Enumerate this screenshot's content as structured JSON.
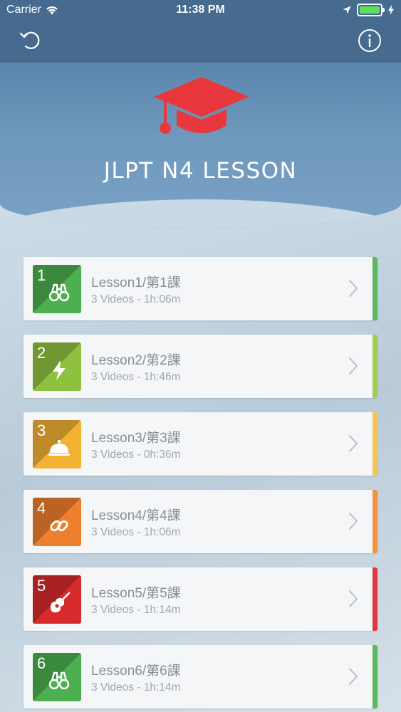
{
  "status_bar": {
    "carrier": "Carrier",
    "time": "11:38 PM"
  },
  "nav": {
    "reload_icon": "reload-icon",
    "info_icon": "info-icon"
  },
  "header": {
    "title": "JLPT N4 LESSON",
    "icon": "graduation-cap-icon",
    "icon_color": "#e8383e"
  },
  "lessons": [
    {
      "number": "1",
      "title": "Lesson1/第1課",
      "subtitle": "3 Videos - 1h:06m",
      "color": "#4caf50",
      "stripe": "#5cb85c",
      "icon": "binoculars-icon"
    },
    {
      "number": "2",
      "title": "Lesson2/第2課",
      "subtitle": "3 Videos - 1h:46m",
      "color": "#8fc140",
      "stripe": "#a3cc52",
      "icon": "lightning-icon"
    },
    {
      "number": "3",
      "title": "Lesson3/第3課",
      "subtitle": "3 Videos - 0h:36m",
      "color": "#f4b233",
      "stripe": "#f6c35a",
      "icon": "service-bell-icon"
    },
    {
      "number": "4",
      "title": "Lesson4/第4課",
      "subtitle": "3 Videos - 1h:06m",
      "color": "#ee7f2c",
      "stripe": "#f09443",
      "icon": "link-icon"
    },
    {
      "number": "5",
      "title": "Lesson5/第5課",
      "subtitle": "3 Videos - 1h:14m",
      "color": "#d62a2d",
      "stripe": "#dc3a3f",
      "icon": "guitar-icon"
    },
    {
      "number": "6",
      "title": "Lesson6/第6課",
      "subtitle": "3 Videos - 1h:14m",
      "color": "#4caf50",
      "stripe": "#5cb85c",
      "icon": "binoculars-icon"
    }
  ]
}
